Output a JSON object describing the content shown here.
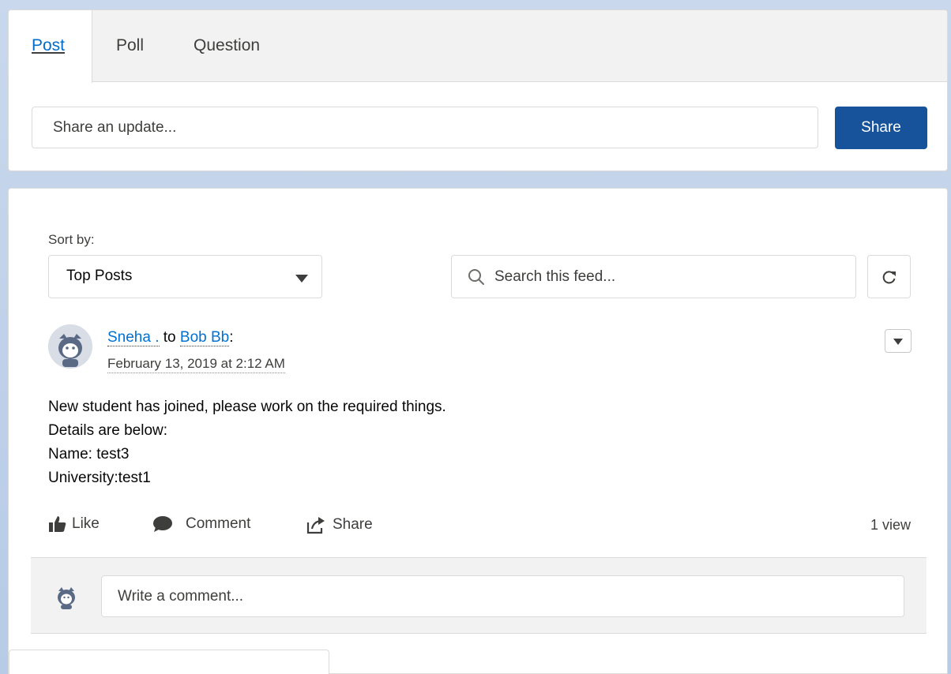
{
  "publisher": {
    "tabs": [
      {
        "label": "Post",
        "active": true
      },
      {
        "label": "Poll",
        "active": false
      },
      {
        "label": "Question",
        "active": false
      }
    ],
    "input_placeholder": "Share an update...",
    "share_label": "Share",
    "share_color": "#16539a"
  },
  "feed": {
    "sort_label": "Sort by:",
    "sort_value": "Top Posts",
    "search_placeholder": "Search this feed...",
    "refresh_icon": "refresh-icon",
    "post": {
      "author": "Sneha .",
      "to_word": " to ",
      "recipient": "Bob Bb",
      "colon": ":",
      "date": "February 13, 2019 at 2:12 AM",
      "body_lines": [
        "New student has joined, please work on the required things.",
        "Details are below:",
        "Name: test3",
        "University:test1"
      ],
      "actions": {
        "like": "Like",
        "comment": "Comment",
        "share": "Share"
      },
      "views": "1 view"
    },
    "comment_placeholder": "Write a comment..."
  },
  "colors": {
    "link": "#0070d2",
    "border": "#dddbda",
    "panel": "#f3f2f2"
  }
}
